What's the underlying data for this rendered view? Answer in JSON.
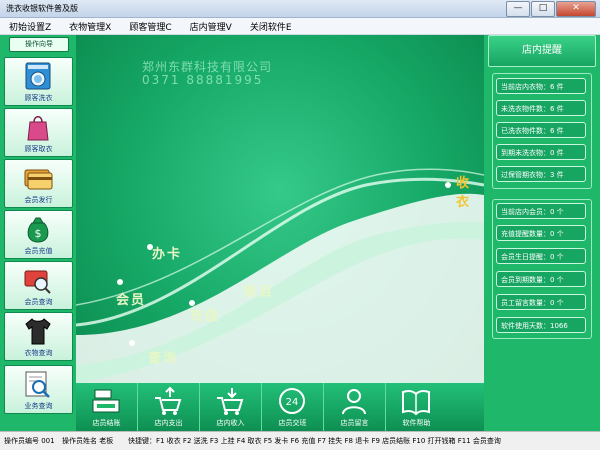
{
  "window": {
    "title": "洗衣收银软件普及版",
    "minimize": "—",
    "maximize": "□",
    "close": "✕"
  },
  "menu": [
    "初始设置Z",
    "衣物管理X",
    "顾客管理C",
    "店内管理V",
    "关闭软件E"
  ],
  "left_nav": {
    "guide": "操作向导",
    "items": [
      {
        "label": "顾客洗衣",
        "icon": "washing-machine-icon"
      },
      {
        "label": "顾客取衣",
        "icon": "shopping-bag-icon"
      },
      {
        "label": "会员发行",
        "icon": "card-icon"
      },
      {
        "label": "会员充值",
        "icon": "money-bag-icon"
      },
      {
        "label": "会员查询",
        "icon": "card-search-icon"
      },
      {
        "label": "衣物查询",
        "icon": "shirt-icon"
      },
      {
        "label": "业务查询",
        "icon": "search-document-icon"
      }
    ]
  },
  "center": {
    "company": "郑州东群科技有限公司",
    "phone": "0371  88881995",
    "words": {
      "a": "办卡",
      "b": "会员",
      "c": "充值",
      "d": "账目",
      "e": "查询",
      "f": "收衣"
    }
  },
  "bottom_nav": [
    {
      "label": "店员结账",
      "icon": "cash-register-icon"
    },
    {
      "label": "店内支出",
      "icon": "cart-out-icon"
    },
    {
      "label": "店内收入",
      "icon": "cart-in-icon"
    },
    {
      "label": "店员交班",
      "icon": "clock-24-icon"
    },
    {
      "label": "店员留言",
      "icon": "person-message-icon"
    },
    {
      "label": "软件帮助",
      "icon": "book-icon"
    }
  ],
  "right_panel": {
    "title": "店内提醒",
    "group1": [
      "当前店内衣物：6 件",
      "未洗衣物件数：6 件",
      "已洗衣物件数：6 件",
      "到期未洗衣物：0 件",
      "过保管期衣物：3 件"
    ],
    "group2": [
      "当前店内会员：0 个",
      "充值提醒数量：0 个",
      "会员生日提醒：0 个",
      "会员到期数量：0 个",
      "员工留言数量：0 个",
      "软件使用天数：1066"
    ]
  },
  "status": {
    "operator_no": "操作员编号  001",
    "operator_name": "操作员姓名  老板",
    "shortcuts": "快捷键：F1 收衣 F2 送洗 F3 上挂 F4 取衣 F5 发卡 F6 充值 F7 挂失 F8 退卡 F9 店员结账 F10 打开钱箱 F11 会员查询"
  },
  "colors": {
    "primary": "#1fb86a",
    "dark": "#0b8a4e",
    "accent": "#e8f7c6"
  }
}
